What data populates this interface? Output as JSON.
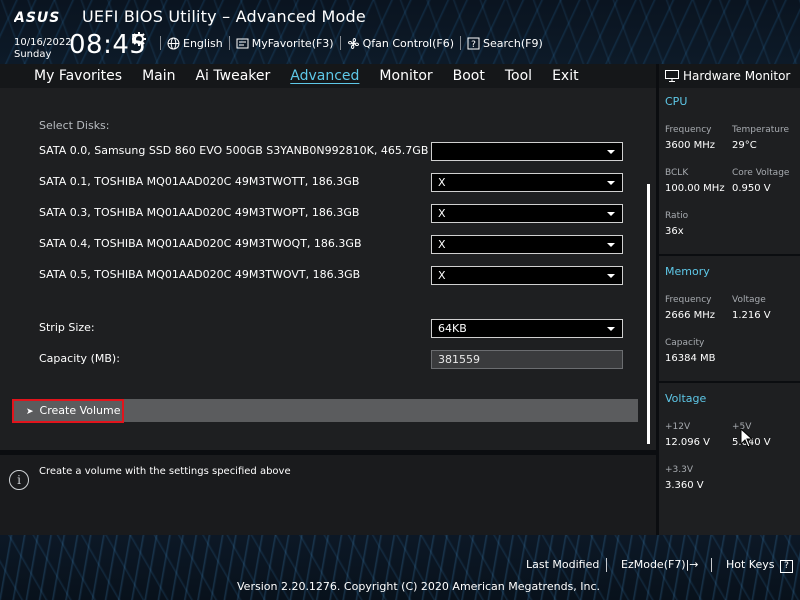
{
  "header": {
    "brand": "ASUS",
    "title": "UEFI BIOS Utility – Advanced Mode",
    "date": "10/16/2022",
    "day": "Sunday",
    "time": "08:45",
    "tools": [
      {
        "label": "English",
        "icon": "globe-icon"
      },
      {
        "label": "MyFavorite(F3)",
        "icon": "favorite-icon"
      },
      {
        "label": "Qfan Control(F6)",
        "icon": "fan-icon"
      },
      {
        "label": "Search(F9)",
        "icon": "search-icon"
      }
    ]
  },
  "menu": {
    "items": [
      "My Favorites",
      "Main",
      "Ai Tweaker",
      "Advanced",
      "Monitor",
      "Boot",
      "Tool",
      "Exit"
    ],
    "active": "Advanced"
  },
  "main": {
    "section_label": "Select Disks:",
    "disks": [
      {
        "label": "SATA 0.0, Samsung SSD 860 EVO 500GB S3YANB0N992810K, 465.7GB",
        "value": ""
      },
      {
        "label": "SATA 0.1, TOSHIBA MQ01AAD020C 49M3TWOTT, 186.3GB",
        "value": "X"
      },
      {
        "label": "SATA 0.3, TOSHIBA MQ01AAD020C 49M3TWOPT, 186.3GB",
        "value": "X"
      },
      {
        "label": "SATA 0.4, TOSHIBA MQ01AAD020C 49M3TWOQT, 186.3GB",
        "value": "X"
      },
      {
        "label": "SATA 0.5, TOSHIBA MQ01AAD020C 49M3TWOVT, 186.3GB",
        "value": "X"
      }
    ],
    "strip_size": {
      "label": "Strip Size:",
      "value": "64KB"
    },
    "capacity": {
      "label": "Capacity (MB):",
      "value": "381559"
    },
    "create_volume": "Create Volume"
  },
  "help": {
    "text": "Create a volume with the settings specified above"
  },
  "hardware_monitor": {
    "title": "Hardware Monitor",
    "cpu": {
      "heading": "CPU",
      "frequency_label": "Frequency",
      "frequency": "3600 MHz",
      "temperature_label": "Temperature",
      "temperature": "29°C",
      "bclk_label": "BCLK",
      "bclk": "100.00 MHz",
      "core_voltage_label": "Core Voltage",
      "core_voltage": "0.950 V",
      "ratio_label": "Ratio",
      "ratio": "36x"
    },
    "memory": {
      "heading": "Memory",
      "frequency_label": "Frequency",
      "frequency": "2666 MHz",
      "voltage_label": "Voltage",
      "voltage": "1.216 V",
      "capacity_label": "Capacity",
      "capacity": "16384 MB"
    },
    "voltage": {
      "heading": "Voltage",
      "v12_label": "+12V",
      "v12": "12.096 V",
      "v5_label": "+5V",
      "v5": "5.040 V",
      "v33_label": "+3.3V",
      "v33": "3.360 V"
    }
  },
  "footer": {
    "last_modified": "Last Modified",
    "ezmode": "EzMode(F7)|→",
    "hotkeys": "Hot Keys",
    "hotkeys_badge": "?",
    "copyright": "Version 2.20.1276. Copyright (C) 2020 American Megatrends, Inc."
  },
  "colors": {
    "accent": "#5ec8e8",
    "highlight_border": "#e2141c",
    "panel": "#1e1f21"
  }
}
